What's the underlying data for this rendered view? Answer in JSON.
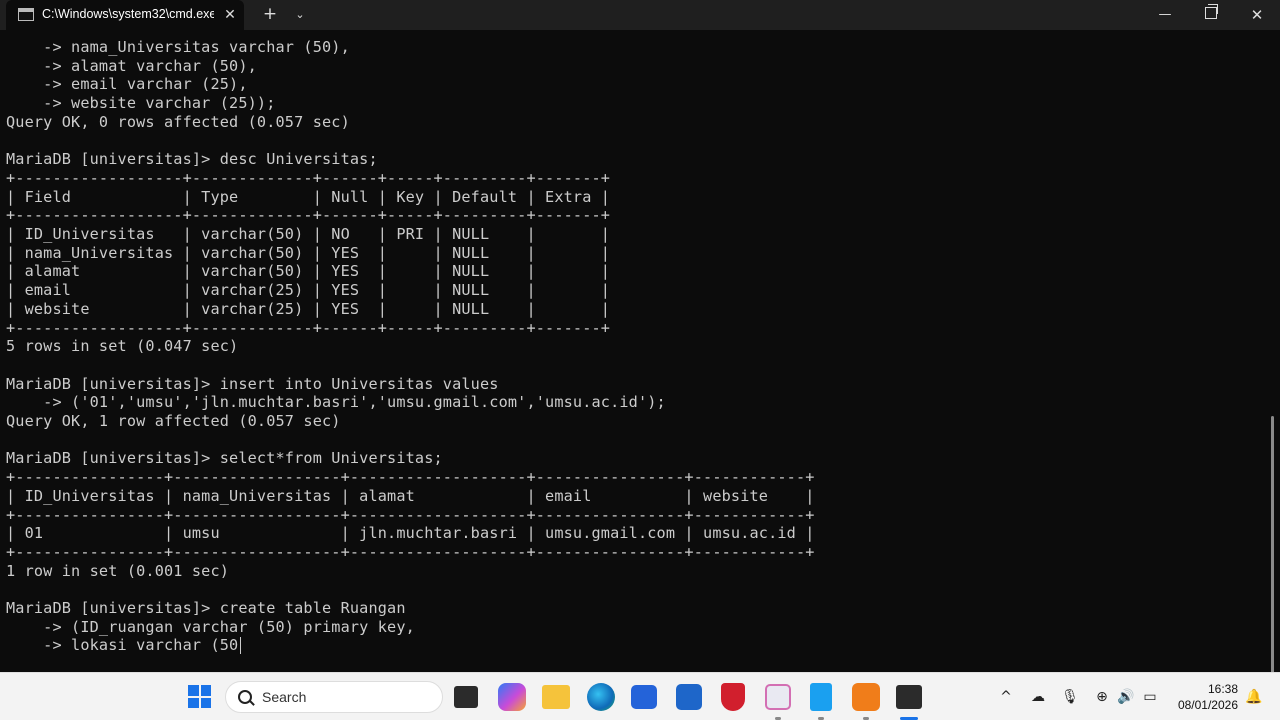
{
  "window": {
    "tab_title": "C:\\Windows\\system32\\cmd.exe",
    "tab_close_glyph": "✕",
    "new_tab_glyph": "+",
    "dropdown_glyph": "⌄",
    "minimize_glyph": "—",
    "close_glyph": "✕"
  },
  "terminal": {
    "lines": [
      "    -> nama_Universitas varchar (50),",
      "    -> alamat varchar (50),",
      "    -> email varchar (25),",
      "    -> website varchar (25));",
      "Query OK, 0 rows affected (0.057 sec)",
      "",
      "MariaDB [universitas]> desc Universitas;",
      "+------------------+-------------+------+-----+---------+-------+",
      "| Field            | Type        | Null | Key | Default | Extra |",
      "+------------------+-------------+------+-----+---------+-------+",
      "| ID_Universitas   | varchar(50) | NO   | PRI | NULL    |       |",
      "| nama_Universitas | varchar(50) | YES  |     | NULL    |       |",
      "| alamat           | varchar(50) | YES  |     | NULL    |       |",
      "| email            | varchar(25) | YES  |     | NULL    |       |",
      "| website          | varchar(25) | YES  |     | NULL    |       |",
      "+------------------+-------------+------+-----+---------+-------+",
      "5 rows in set (0.047 sec)",
      "",
      "MariaDB [universitas]> insert into Universitas values",
      "    -> ('01','umsu','jln.muchtar.basri','umsu.gmail.com','umsu.ac.id');",
      "Query OK, 1 row affected (0.057 sec)",
      "",
      "MariaDB [universitas]> select*from Universitas;",
      "+----------------+------------------+-------------------+----------------+------------+",
      "| ID_Universitas | nama_Universitas | alamat            | email          | website    |",
      "+----------------+------------------+-------------------+----------------+------------+",
      "| 01             | umsu             | jln.muchtar.basri | umsu.gmail.com | umsu.ac.id |",
      "+----------------+------------------+-------------------+----------------+------------+",
      "1 row in set (0.001 sec)",
      "",
      "MariaDB [universitas]> create table Ruangan",
      "    -> (ID_ruangan varchar (50) primary key,",
      "    -> lokasi varchar (50"
    ]
  },
  "taskbar": {
    "search_label": "Search",
    "apps": [
      "file-manager-app",
      "copilot-app",
      "file-explorer-app",
      "edge-app",
      "store-app",
      "visual-studio-app",
      "mcafee-app",
      "snipping-tool-app",
      "notepad-app",
      "xampp-app",
      "terminal-app"
    ],
    "tray_chevron": "^",
    "time": "16:38",
    "date": "08/01/2026"
  },
  "colors": {
    "terminal_bg": "#0c0c0c",
    "terminal_text": "#cccccc",
    "titlebar_bg": "#1f1f1f",
    "taskbar_bg": "#f3f3f3"
  }
}
